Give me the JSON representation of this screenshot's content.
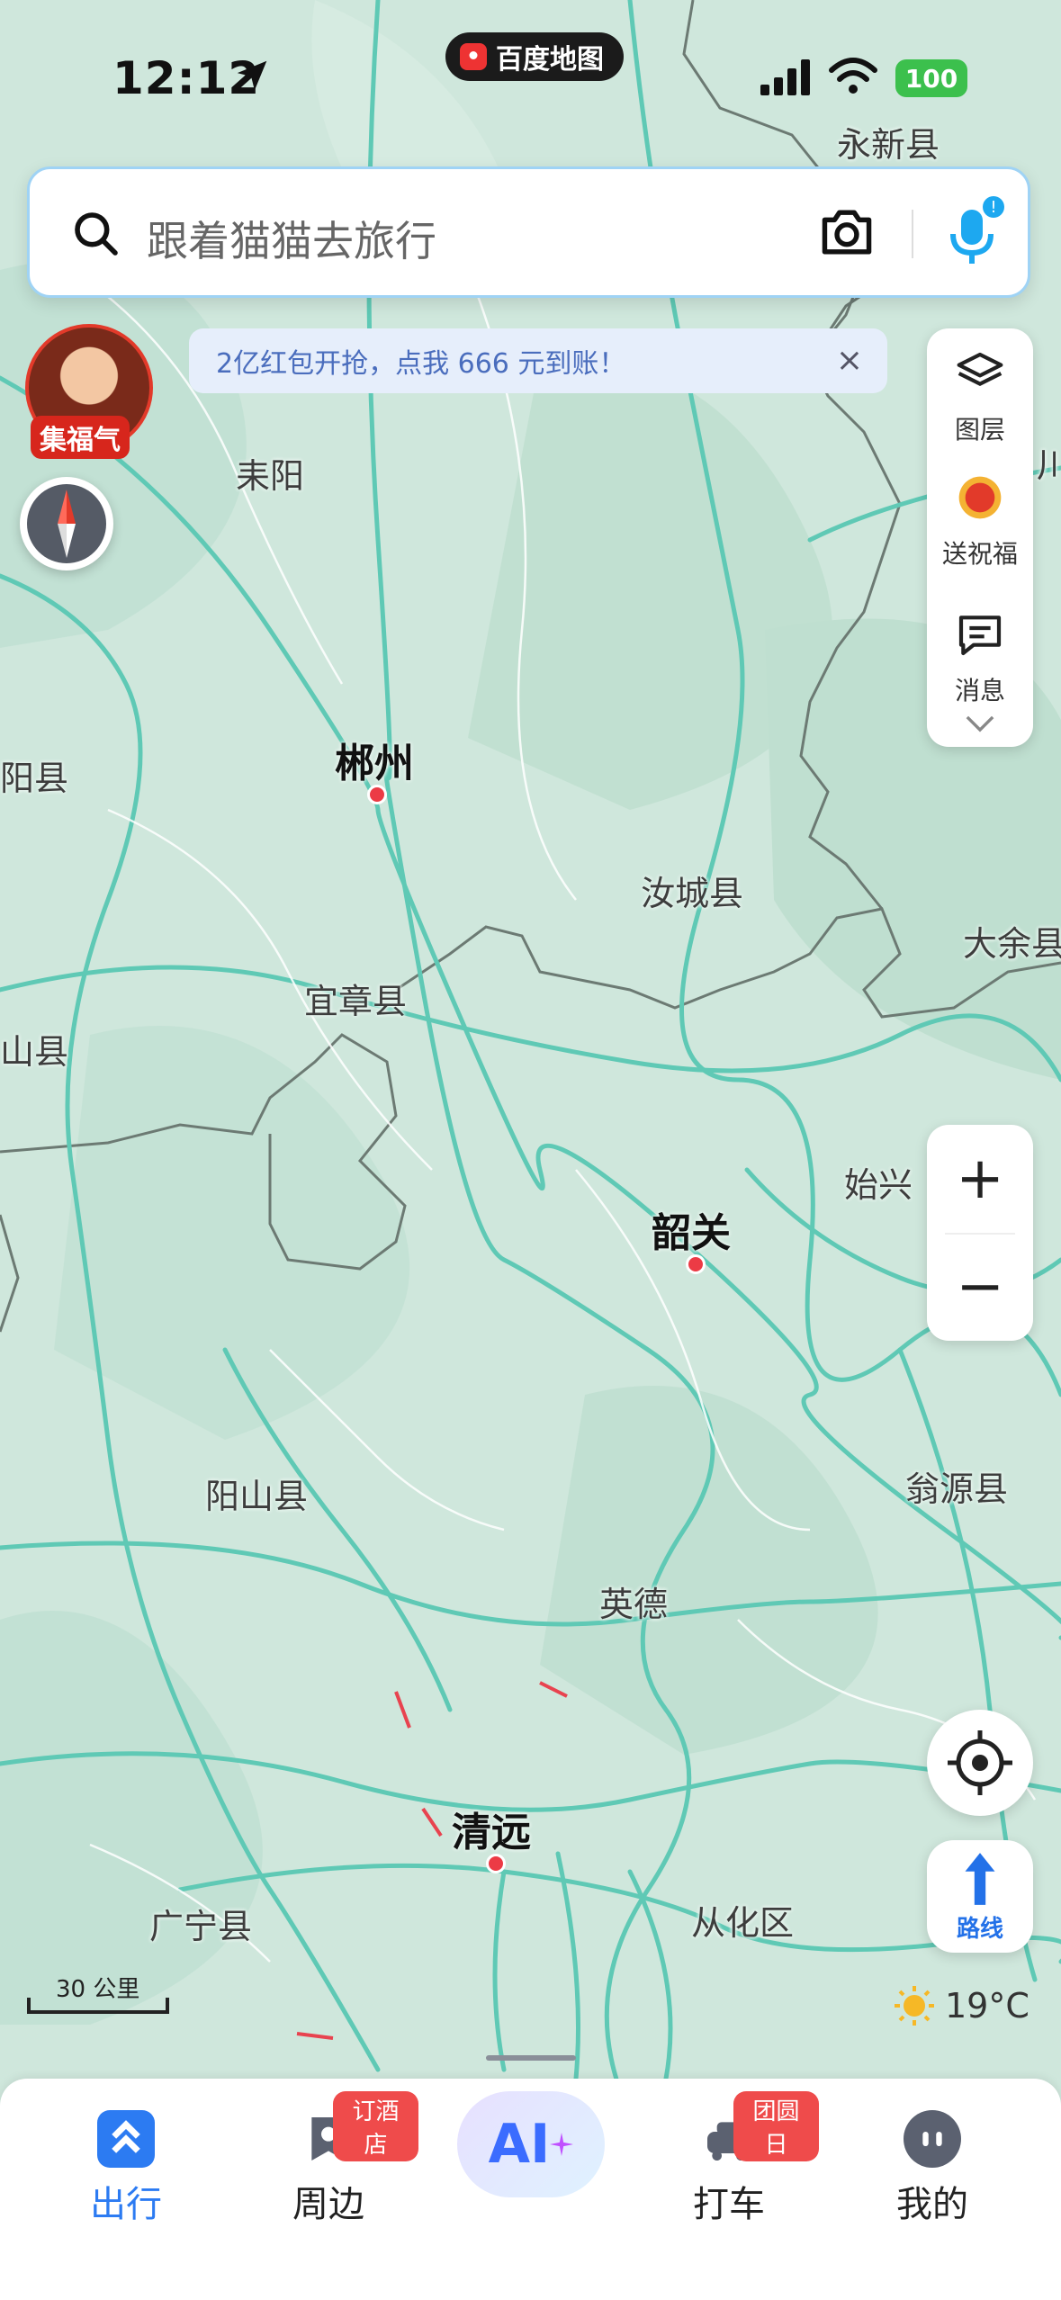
{
  "status_bar": {
    "time": "12:12",
    "app_pill": "百度地图",
    "battery": "100"
  },
  "search": {
    "placeholder": "跟着猫猫去旅行"
  },
  "banner": {
    "text": "2亿红包开抢，点我 666 元到账！",
    "close": "×"
  },
  "avatar": {
    "tag": "集福气"
  },
  "tools": {
    "layers": "图层",
    "blessing": "送祝福",
    "messages": "消息"
  },
  "zoom": {
    "in": "+",
    "out": "−"
  },
  "route": {
    "label": "路线"
  },
  "scale": {
    "label": "30 公里"
  },
  "weather": {
    "temp": "19°C"
  },
  "cities": [
    {
      "name": "永新县",
      "big": false
    },
    {
      "name": "耒阳",
      "big": false
    },
    {
      "name": "郴州",
      "big": true
    },
    {
      "name": "汝城县",
      "big": false
    },
    {
      "name": "大余县",
      "big": false
    },
    {
      "name": "宜章县",
      "big": false
    },
    {
      "name": "山县",
      "big": false
    },
    {
      "name": "阳县",
      "big": false
    },
    {
      "name": "始兴",
      "big": false
    },
    {
      "name": "韶关",
      "big": true
    },
    {
      "name": "阳山县",
      "big": false
    },
    {
      "name": "翁源县",
      "big": false
    },
    {
      "name": "英德",
      "big": false
    },
    {
      "name": "清远",
      "big": true
    },
    {
      "name": "广宁县",
      "big": false
    },
    {
      "name": "从化区",
      "big": false
    },
    {
      "name": "川",
      "big": false
    }
  ],
  "nav": {
    "items": [
      {
        "label": "出行",
        "active": true
      },
      {
        "label": "周边",
        "badge": "订酒店"
      },
      {
        "label": "AI"
      },
      {
        "label": "打车",
        "badge": "团圆日"
      },
      {
        "label": "我的"
      }
    ]
  },
  "colors": {
    "accent": "#2371e8",
    "map_bg": "#cfe7dc",
    "road": "#5fc9b5",
    "badge": "#ef4b4b"
  }
}
